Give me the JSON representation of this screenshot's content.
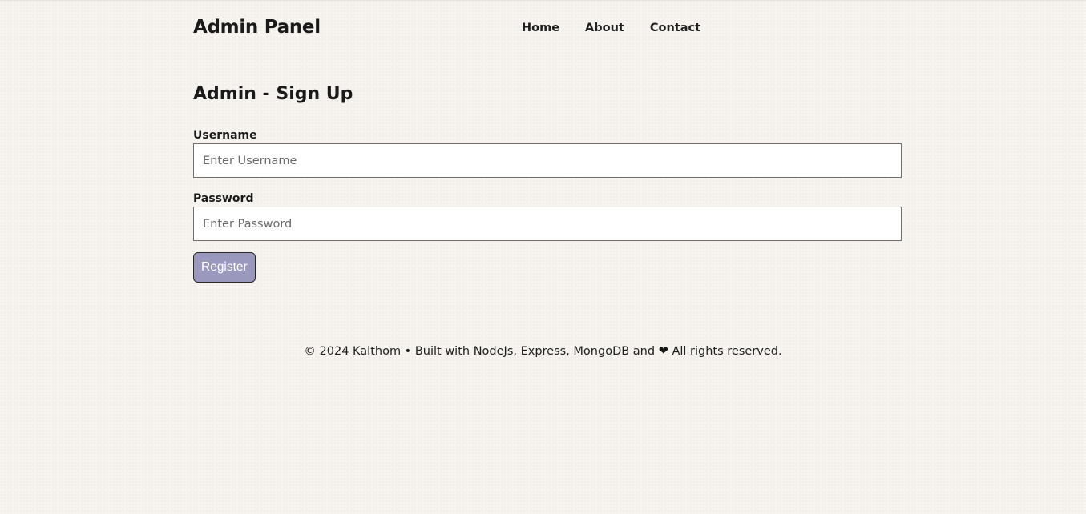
{
  "header": {
    "logo": "Admin Panel",
    "nav": [
      {
        "label": "Home"
      },
      {
        "label": "About"
      },
      {
        "label": "Contact"
      }
    ]
  },
  "main": {
    "title": "Admin - Sign Up",
    "username": {
      "label": "Username",
      "placeholder": "Enter Username",
      "value": ""
    },
    "password": {
      "label": "Password",
      "placeholder": "Enter Password",
      "value": ""
    },
    "register_label": "Register"
  },
  "footer": {
    "text_before": "© 2024 Kalthom • Built with NodeJs, Express, MongoDB and",
    "heart_icon": "❤",
    "text_after": "All rights reserved."
  },
  "colors": {
    "background": "#f7f3ee",
    "button": "#9a98bd",
    "text": "#1a1a1a"
  }
}
